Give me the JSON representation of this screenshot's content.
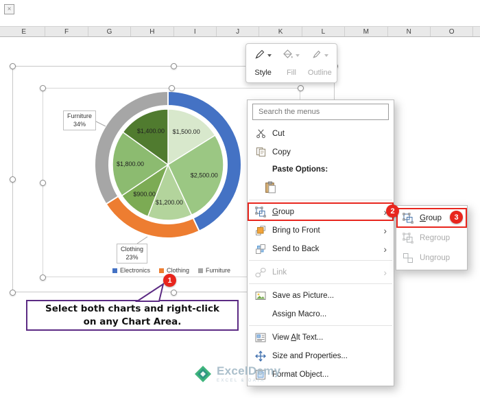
{
  "corner_icon": "×",
  "colors": {
    "annotation_red": "#e8251d",
    "callout_purple": "#5b2a83",
    "electronics_blue": "#4472c4",
    "clothing_orange": "#ed7d31",
    "furniture_gray": "#a6a6a6"
  },
  "sheet": {
    "columns": [
      "E",
      "F",
      "G",
      "H",
      "I",
      "J",
      "K",
      "L",
      "M",
      "N",
      "O"
    ]
  },
  "mini_toolbar": {
    "items": [
      {
        "label": "Style",
        "icon": "style-pen",
        "enabled": true
      },
      {
        "label": "Fill",
        "icon": "fill-bucket",
        "enabled": false
      },
      {
        "label": "Outline",
        "icon": "outline-pen",
        "enabled": false
      }
    ]
  },
  "context_menu": {
    "search_placeholder": "Search the menus",
    "items": [
      {
        "type": "item",
        "label": "Cut",
        "icon": "scissors"
      },
      {
        "type": "item",
        "label": "Copy",
        "icon": "copy"
      },
      {
        "type": "caption",
        "label": "Paste Options:"
      },
      {
        "type": "paste-options",
        "icon": "paste"
      },
      {
        "type": "separator"
      },
      {
        "type": "item",
        "label": "Group",
        "icon": "group",
        "submenu": true,
        "highlighted": true,
        "underline_at": 0,
        "badge": "2"
      },
      {
        "type": "item",
        "label": "Bring to Front",
        "icon": "bring-front",
        "submenu": true
      },
      {
        "type": "item",
        "label": "Send to Back",
        "icon": "send-back",
        "submenu": true
      },
      {
        "type": "separator"
      },
      {
        "type": "item",
        "label": "Link",
        "icon": "link",
        "submenu": true,
        "enabled": false
      },
      {
        "type": "separator"
      },
      {
        "type": "item",
        "label": "Save as Picture...",
        "icon": "picture"
      },
      {
        "type": "item",
        "label": "Assign Macro..."
      },
      {
        "type": "separator"
      },
      {
        "type": "item",
        "label": "View Alt Text...",
        "icon": "alt-text",
        "underline_at": 5
      },
      {
        "type": "item",
        "label": "Size and Properties...",
        "icon": "size-props"
      },
      {
        "type": "item",
        "label": "Format Object...",
        "icon": "format"
      }
    ]
  },
  "submenu": {
    "items": [
      {
        "label": "Group",
        "icon": "group",
        "underline_at": 0,
        "enabled": true,
        "highlighted": true,
        "badge": "3"
      },
      {
        "label": "Regroup",
        "icon": "group",
        "enabled": false
      },
      {
        "label": "Ungroup",
        "icon": "ungroup",
        "enabled": false
      }
    ]
  },
  "annotations": {
    "step1": "1",
    "step2": "2",
    "step3": "3",
    "callout": {
      "line1": "Select both charts and right-click",
      "line2": "on any Chart Area."
    }
  },
  "watermark": {
    "brand": "ExcelDemy",
    "tagline": "EXCEL & DATA"
  },
  "chart_data": {
    "type": "pie",
    "title": "",
    "series": [
      {
        "name": "inner-pie-values",
        "labels": [
          "$1,500.00",
          "$2,500.00",
          "$1,200.00",
          "$900.00",
          "$1,800.00",
          "$1,400.00"
        ],
        "values": [
          1500,
          2500,
          1200,
          900,
          1800,
          1400
        ],
        "colors": [
          "#d8e8cc",
          "#9bc783",
          "#b3d49c",
          "#7cab54",
          "#8cbb70",
          "#507b2f"
        ]
      },
      {
        "name": "outer-doughnut-categories",
        "categories": [
          "Electronics",
          "Clothing",
          "Furniture"
        ],
        "values": [
          43,
          23,
          34
        ],
        "colors": [
          "#4472c4",
          "#ed7d31",
          "#a6a6a6"
        ]
      }
    ],
    "category_labels": [
      {
        "name": "Furniture",
        "percent": "34%"
      },
      {
        "name": "Clothing",
        "percent": "23%"
      }
    ],
    "legend": {
      "position": "bottom",
      "entries": [
        "Electronics",
        "Clothing",
        "Furniture"
      ],
      "colors": [
        "#4472c4",
        "#ed7d31",
        "#a6a6a6"
      ]
    }
  }
}
